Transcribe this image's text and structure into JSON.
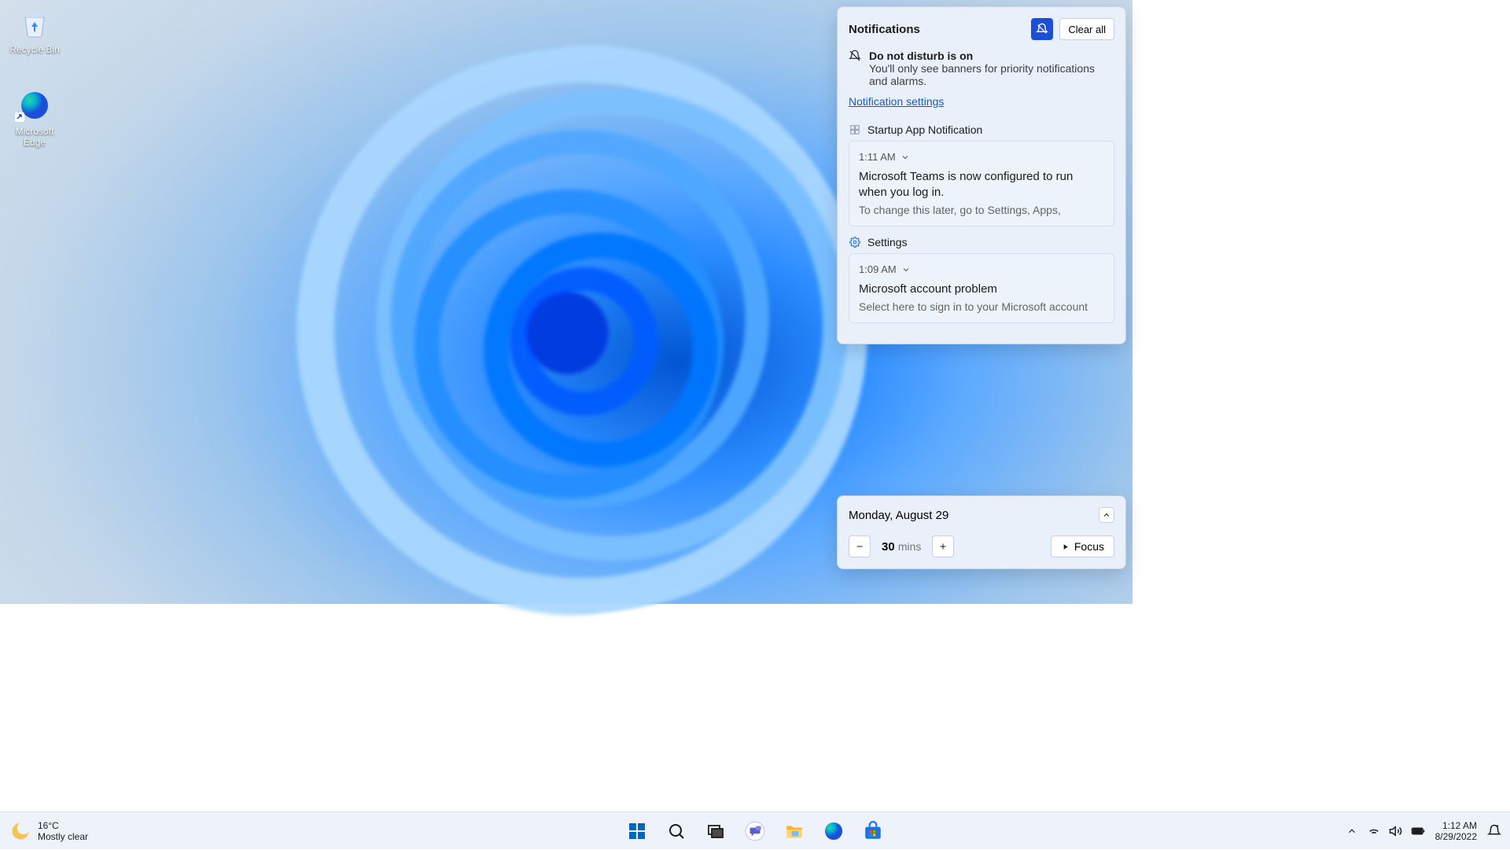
{
  "desktop": {
    "icons": [
      {
        "name": "Recycle Bin"
      },
      {
        "name": "Microsoft Edge"
      }
    ]
  },
  "taskbar": {
    "weather": {
      "temp": "16°C",
      "condition": "Mostly clear"
    },
    "tray": {
      "time": "1:12 AM",
      "date": "8/29/2022"
    }
  },
  "notifications": {
    "title": "Notifications",
    "clear_all": "Clear all",
    "dnd": {
      "title": "Do not disturb is on",
      "body": "You'll only see banners for priority notifications and alarms."
    },
    "settings_link": "Notification settings",
    "groups": [
      {
        "app": "Startup App Notification",
        "items": [
          {
            "time": "1:11 AM",
            "title": "Microsoft Teams is now configured to run when you log in.",
            "body": "To change this later, go to Settings, Apps,"
          }
        ]
      },
      {
        "app": "Settings",
        "items": [
          {
            "time": "1:09 AM",
            "title": "Microsoft account problem",
            "body": "Select here to sign in to your Microsoft account"
          }
        ]
      }
    ]
  },
  "calendar": {
    "date_label": "Monday, August 29",
    "focus": {
      "value": "30",
      "unit": "mins",
      "button": "Focus"
    }
  }
}
